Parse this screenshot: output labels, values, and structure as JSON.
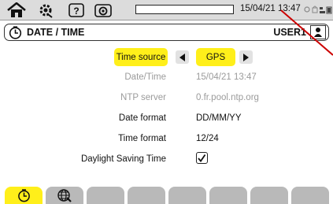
{
  "statusbar": {
    "datetime": "15/04/21 13:47",
    "icons": [
      "home-icon",
      "settings-icon",
      "help-icon",
      "camera-icon"
    ],
    "right_icons": "⎔ 🔒 ⚇ ▦"
  },
  "header": {
    "title": "DATE / TIME",
    "user": "USER1"
  },
  "form": {
    "time_source": {
      "label": "Time source",
      "value": "GPS"
    },
    "datetime": {
      "label": "Date/Time",
      "value": "15/04/21 13:47"
    },
    "ntp_server": {
      "label": "NTP server",
      "value": "0.fr.pool.ntp.org"
    },
    "date_format": {
      "label": "Date format",
      "value": "DD/MM/YY"
    },
    "time_format": {
      "label": "Time format",
      "value": "12/24"
    },
    "dst": {
      "label": "Daylight Saving Time",
      "checked": true
    }
  },
  "tabs": {
    "active_index": 0,
    "items": [
      "clock-icon",
      "globe-icon",
      "",
      "",
      "",
      "",
      "",
      "",
      ""
    ]
  },
  "colors": {
    "highlight": "#ffef1a",
    "tab_inactive": "#b9b9b9",
    "annotation_arrow": "#cc0000"
  }
}
